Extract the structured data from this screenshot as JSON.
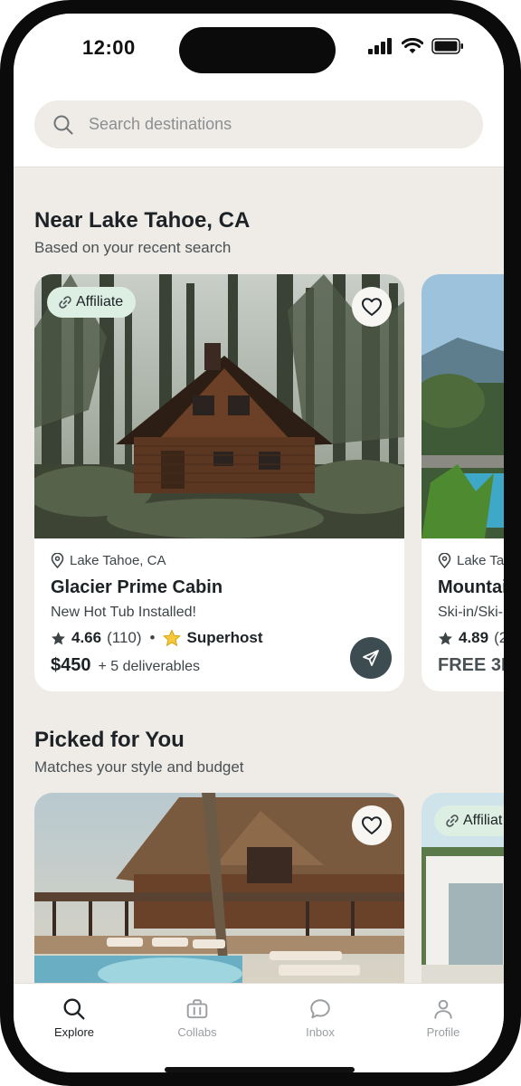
{
  "status": {
    "time": "12:00"
  },
  "search": {
    "placeholder": "Search destinations",
    "value": ""
  },
  "sections": [
    {
      "title": "Near Lake Tahoe, CA",
      "subtitle": "Based on your recent search",
      "cards": [
        {
          "badge": "Affiliate",
          "location": "Lake Tahoe, CA",
          "title": "Glacier Prime Cabin",
          "description": "New Hot Tub Installed!",
          "rating": "4.66",
          "reviews": "(110)",
          "host_badge": "Superhost",
          "price": "$450",
          "extras": "+ 5 deliverables"
        },
        {
          "location": "Lake Ta",
          "title": "Mountai",
          "description": "Ski-in/Ski-",
          "rating": "4.89",
          "reviews": "(2",
          "price": "FREE 3D"
        }
      ]
    },
    {
      "title": "Picked for You",
      "subtitle": "Matches your style and budget",
      "cards": [
        {
          "image": "lodge-with-pool"
        },
        {
          "badge": "Affiliat",
          "image": "modern-villa"
        }
      ]
    }
  ],
  "tabs": [
    {
      "label": "Explore",
      "icon": "search-icon",
      "active": true
    },
    {
      "label": "Collabs",
      "icon": "briefcase-icon",
      "active": false
    },
    {
      "label": "Inbox",
      "icon": "chat-bubble-icon",
      "active": false
    },
    {
      "label": "Profile",
      "icon": "person-icon",
      "active": false
    }
  ],
  "colors": {
    "accent": "#3c4c50",
    "background": "#efebe6",
    "affiliate_badge": "#dcefe2",
    "tab_active": "#1c2226",
    "tab_inactive": "#9a9ea0"
  }
}
